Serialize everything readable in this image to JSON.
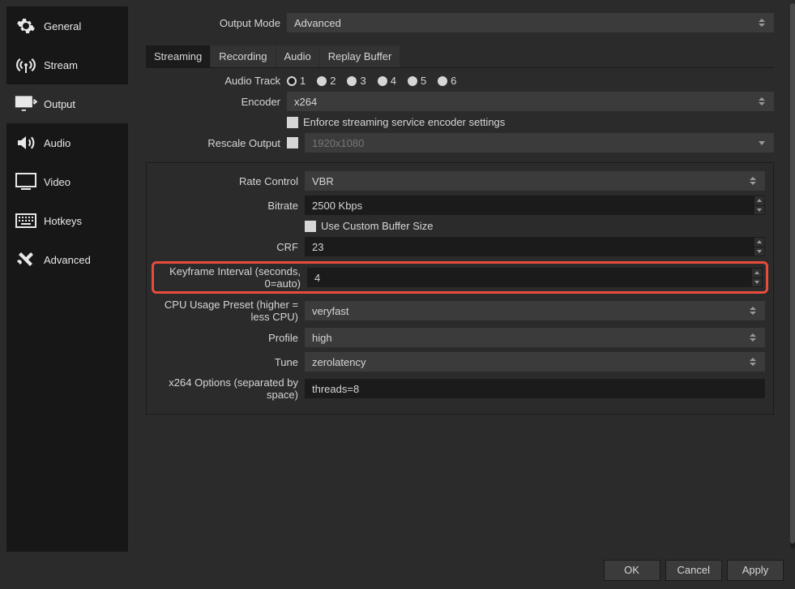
{
  "sidebar": {
    "items": [
      {
        "label": "General"
      },
      {
        "label": "Stream"
      },
      {
        "label": "Output"
      },
      {
        "label": "Audio"
      },
      {
        "label": "Video"
      },
      {
        "label": "Hotkeys"
      },
      {
        "label": "Advanced"
      }
    ]
  },
  "output_mode": {
    "label": "Output Mode",
    "value": "Advanced"
  },
  "tabs": {
    "streaming": "Streaming",
    "recording": "Recording",
    "audio": "Audio",
    "replay": "Replay Buffer"
  },
  "audio_track": {
    "label": "Audio Track",
    "options": [
      "1",
      "2",
      "3",
      "4",
      "5",
      "6"
    ],
    "selected": "1"
  },
  "encoder": {
    "label": "Encoder",
    "value": "x264"
  },
  "enforce": {
    "label": "Enforce streaming service encoder settings"
  },
  "rescale": {
    "label": "Rescale Output",
    "value": "1920x1080"
  },
  "rate_control": {
    "label": "Rate Control",
    "value": "VBR"
  },
  "bitrate": {
    "label": "Bitrate",
    "value": "2500 Kbps"
  },
  "custom_buffer": {
    "label": "Use Custom Buffer Size"
  },
  "crf": {
    "label": "CRF",
    "value": "23"
  },
  "keyframe": {
    "label": "Keyframe Interval (seconds, 0=auto)",
    "value": "4"
  },
  "cpu_preset": {
    "label": "CPU Usage Preset (higher = less CPU)",
    "value": "veryfast"
  },
  "profile": {
    "label": "Profile",
    "value": "high"
  },
  "tune": {
    "label": "Tune",
    "value": "zerolatency"
  },
  "x264_opts": {
    "label": "x264 Options (separated by space)",
    "value": "threads=8"
  },
  "buttons": {
    "ok": "OK",
    "cancel": "Cancel",
    "apply": "Apply"
  }
}
